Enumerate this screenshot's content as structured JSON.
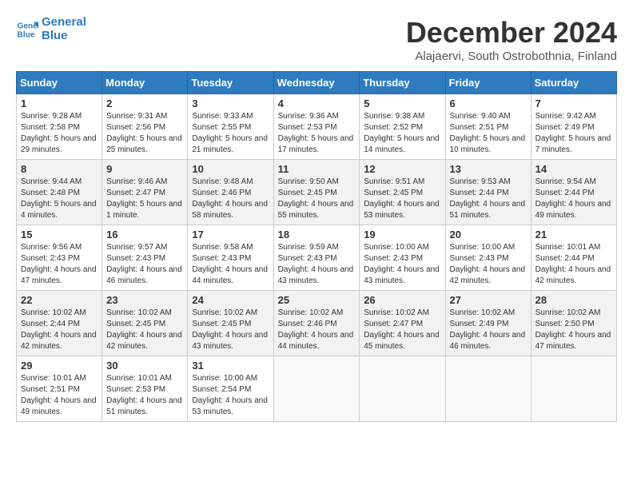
{
  "header": {
    "logo_line1": "General",
    "logo_line2": "Blue",
    "month": "December 2024",
    "location": "Alajaervi, South Ostrobothnia, Finland"
  },
  "days_of_week": [
    "Sunday",
    "Monday",
    "Tuesday",
    "Wednesday",
    "Thursday",
    "Friday",
    "Saturday"
  ],
  "weeks": [
    [
      {
        "day": 1,
        "sunrise": "9:28 AM",
        "sunset": "2:58 PM",
        "daylight": "5 hours and 29 minutes."
      },
      {
        "day": 2,
        "sunrise": "9:31 AM",
        "sunset": "2:56 PM",
        "daylight": "5 hours and 25 minutes."
      },
      {
        "day": 3,
        "sunrise": "9:33 AM",
        "sunset": "2:55 PM",
        "daylight": "5 hours and 21 minutes."
      },
      {
        "day": 4,
        "sunrise": "9:36 AM",
        "sunset": "2:53 PM",
        "daylight": "5 hours and 17 minutes."
      },
      {
        "day": 5,
        "sunrise": "9:38 AM",
        "sunset": "2:52 PM",
        "daylight": "5 hours and 14 minutes."
      },
      {
        "day": 6,
        "sunrise": "9:40 AM",
        "sunset": "2:51 PM",
        "daylight": "5 hours and 10 minutes."
      },
      {
        "day": 7,
        "sunrise": "9:42 AM",
        "sunset": "2:49 PM",
        "daylight": "5 hours and 7 minutes."
      }
    ],
    [
      {
        "day": 8,
        "sunrise": "9:44 AM",
        "sunset": "2:48 PM",
        "daylight": "5 hours and 4 minutes."
      },
      {
        "day": 9,
        "sunrise": "9:46 AM",
        "sunset": "2:47 PM",
        "daylight": "5 hours and 1 minute."
      },
      {
        "day": 10,
        "sunrise": "9:48 AM",
        "sunset": "2:46 PM",
        "daylight": "4 hours and 58 minutes."
      },
      {
        "day": 11,
        "sunrise": "9:50 AM",
        "sunset": "2:45 PM",
        "daylight": "4 hours and 55 minutes."
      },
      {
        "day": 12,
        "sunrise": "9:51 AM",
        "sunset": "2:45 PM",
        "daylight": "4 hours and 53 minutes."
      },
      {
        "day": 13,
        "sunrise": "9:53 AM",
        "sunset": "2:44 PM",
        "daylight": "4 hours and 51 minutes."
      },
      {
        "day": 14,
        "sunrise": "9:54 AM",
        "sunset": "2:44 PM",
        "daylight": "4 hours and 49 minutes."
      }
    ],
    [
      {
        "day": 15,
        "sunrise": "9:56 AM",
        "sunset": "2:43 PM",
        "daylight": "4 hours and 47 minutes."
      },
      {
        "day": 16,
        "sunrise": "9:57 AM",
        "sunset": "2:43 PM",
        "daylight": "4 hours and 46 minutes."
      },
      {
        "day": 17,
        "sunrise": "9:58 AM",
        "sunset": "2:43 PM",
        "daylight": "4 hours and 44 minutes."
      },
      {
        "day": 18,
        "sunrise": "9:59 AM",
        "sunset": "2:43 PM",
        "daylight": "4 hours and 43 minutes."
      },
      {
        "day": 19,
        "sunrise": "10:00 AM",
        "sunset": "2:43 PM",
        "daylight": "4 hours and 43 minutes."
      },
      {
        "day": 20,
        "sunrise": "10:00 AM",
        "sunset": "2:43 PM",
        "daylight": "4 hours and 42 minutes."
      },
      {
        "day": 21,
        "sunrise": "10:01 AM",
        "sunset": "2:44 PM",
        "daylight": "4 hours and 42 minutes."
      }
    ],
    [
      {
        "day": 22,
        "sunrise": "10:02 AM",
        "sunset": "2:44 PM",
        "daylight": "4 hours and 42 minutes."
      },
      {
        "day": 23,
        "sunrise": "10:02 AM",
        "sunset": "2:45 PM",
        "daylight": "4 hours and 42 minutes."
      },
      {
        "day": 24,
        "sunrise": "10:02 AM",
        "sunset": "2:45 PM",
        "daylight": "4 hours and 43 minutes."
      },
      {
        "day": 25,
        "sunrise": "10:02 AM",
        "sunset": "2:46 PM",
        "daylight": "4 hours and 44 minutes."
      },
      {
        "day": 26,
        "sunrise": "10:02 AM",
        "sunset": "2:47 PM",
        "daylight": "4 hours and 45 minutes."
      },
      {
        "day": 27,
        "sunrise": "10:02 AM",
        "sunset": "2:49 PM",
        "daylight": "4 hours and 46 minutes."
      },
      {
        "day": 28,
        "sunrise": "10:02 AM",
        "sunset": "2:50 PM",
        "daylight": "4 hours and 47 minutes."
      }
    ],
    [
      {
        "day": 29,
        "sunrise": "10:01 AM",
        "sunset": "2:51 PM",
        "daylight": "4 hours and 49 minutes."
      },
      {
        "day": 30,
        "sunrise": "10:01 AM",
        "sunset": "2:53 PM",
        "daylight": "4 hours and 51 minutes."
      },
      {
        "day": 31,
        "sunrise": "10:00 AM",
        "sunset": "2:54 PM",
        "daylight": "4 hours and 53 minutes."
      },
      null,
      null,
      null,
      null
    ]
  ]
}
